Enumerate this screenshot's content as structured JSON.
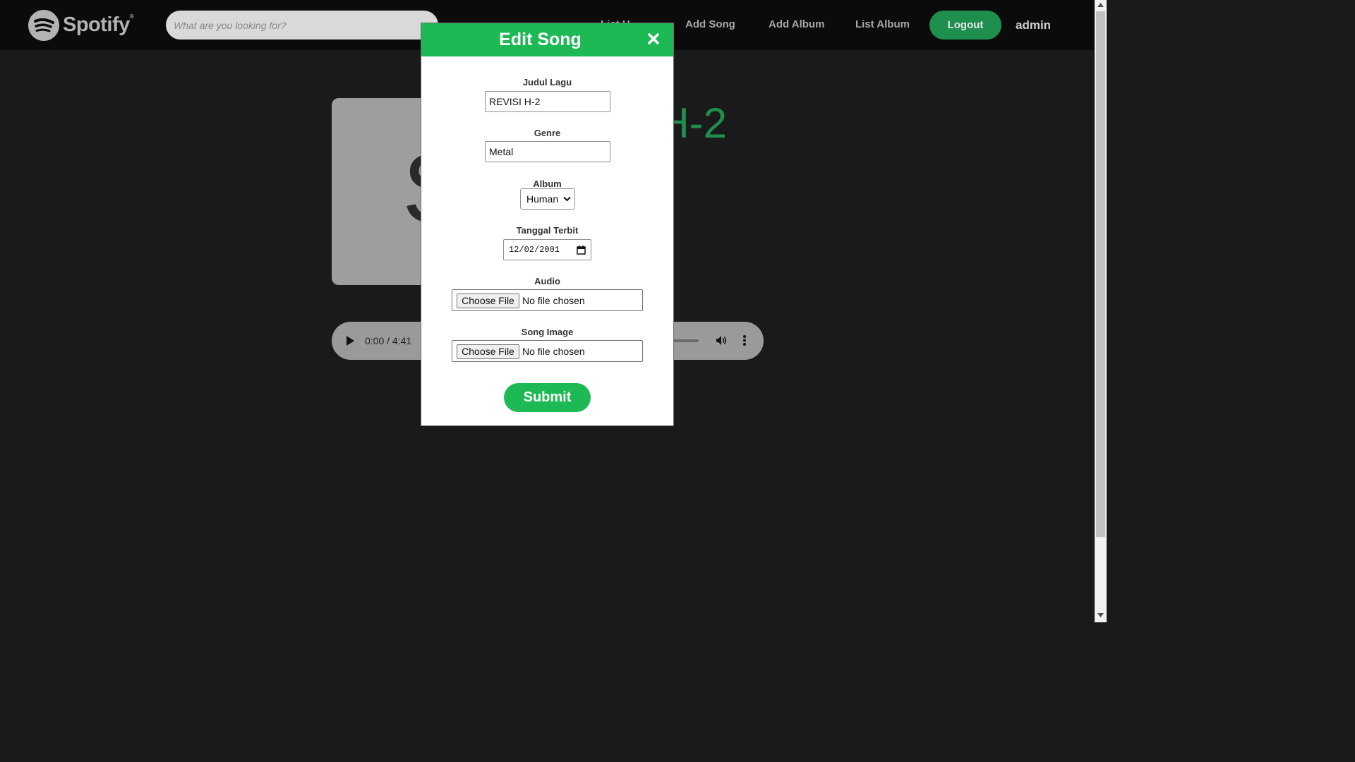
{
  "navbar": {
    "logo_text": "Spotify",
    "logo_mark": "®",
    "search_placeholder": "What are you looking for?",
    "links": [
      "List U",
      "Add Song",
      "Add Album",
      "List Album"
    ],
    "logout_label": "Logout",
    "username": "admin"
  },
  "song": {
    "cover_letter": "S",
    "title_visible": "I H-2",
    "audio_time": "0:00 / 4:41"
  },
  "modal": {
    "title": "Edit Song",
    "fields": {
      "judul_label": "Judul Lagu",
      "judul_value": "REVISI H-2",
      "genre_label": "Genre",
      "genre_value": "Metal",
      "album_label": "Album",
      "album_value": "Human",
      "tanggal_label": "Tanggal Terbit",
      "tanggal_value": "12/02/2001",
      "audio_label": "Audio",
      "song_image_label": "Song Image"
    },
    "file_button": "Choose File",
    "file_status": "No file chosen",
    "submit_label": "Submit"
  },
  "colors": {
    "accent": "#1db954",
    "logout_bg": "#1f8f4e",
    "background": "#1a1a1a",
    "navbar": "#0b0b0b"
  },
  "icons": [
    "spotify-logo-icon",
    "close-icon",
    "chevron-down-icon",
    "calendar-icon",
    "play-icon",
    "volume-icon",
    "more-vertical-icon"
  ]
}
